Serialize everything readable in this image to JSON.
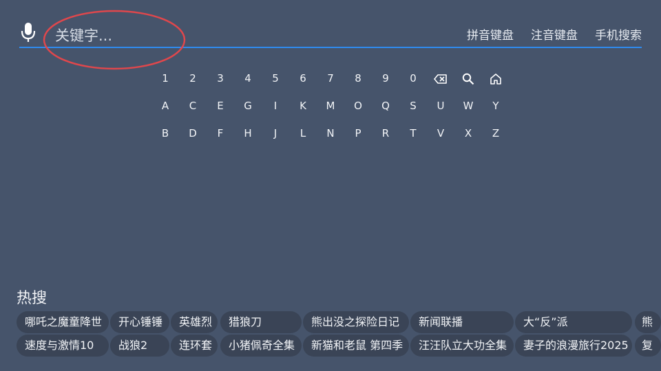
{
  "search": {
    "placeholder": "关键字..."
  },
  "modes": [
    "拼音键盘",
    "注音键盘",
    "手机搜索"
  ],
  "keyboard": {
    "row1": [
      "1",
      "2",
      "3",
      "4",
      "5",
      "6",
      "7",
      "8",
      "9",
      "0"
    ],
    "row2": [
      "A",
      "C",
      "E",
      "G",
      "I",
      "K",
      "M",
      "O",
      "Q",
      "S",
      "U",
      "W",
      "Y"
    ],
    "row3": [
      "B",
      "D",
      "F",
      "H",
      "J",
      "L",
      "N",
      "P",
      "R",
      "T",
      "V",
      "X",
      "Z"
    ],
    "icons": [
      "backspace-icon",
      "search-icon",
      "home-icon"
    ]
  },
  "hot": {
    "title": "热搜",
    "row1": [
      "哪吒之魔童降世",
      "开心锤锤",
      "英雄烈",
      "猎狼刀",
      "熊出没之探险日记",
      "新闻联播",
      "大“反”派",
      "熊"
    ],
    "row2": [
      "速度与激情10",
      "战狼2",
      "连环套",
      "小猪佩奇全集",
      "新猫和老鼠 第四季",
      "汪汪队立大功全集",
      "妻子的浪漫旅行2025",
      "复"
    ]
  },
  "colors": {
    "background": "#46546b",
    "underline": "#2f8cf0",
    "chip": "#3a4456",
    "annotation": "#e0474c"
  }
}
